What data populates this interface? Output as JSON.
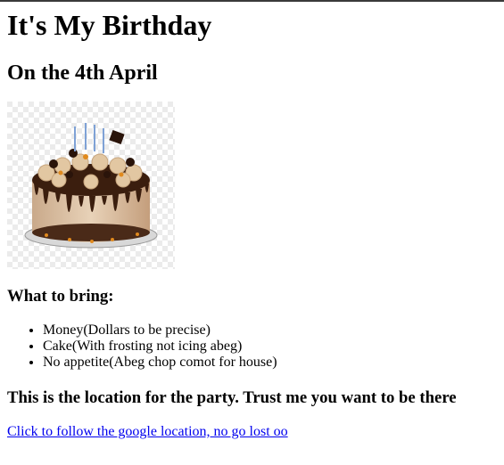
{
  "page": {
    "title": "It's My Birthday",
    "date_heading": "On the 4th April"
  },
  "image": {
    "alt": "Chocolate drip birthday cake with candles"
  },
  "bring": {
    "heading": "What to bring:",
    "items": [
      "Money(Dollars to be precise)",
      "Cake(With frosting not icing abeg)",
      "No appetite(Abeg chop comot for house)"
    ]
  },
  "location": {
    "heading": "This is the location for the party. Trust me you want to be there",
    "link_text": "Click to follow the google location, no go lost oo"
  },
  "colors": {
    "link": "#0000ee",
    "text": "#000000",
    "background": "#ffffff"
  }
}
